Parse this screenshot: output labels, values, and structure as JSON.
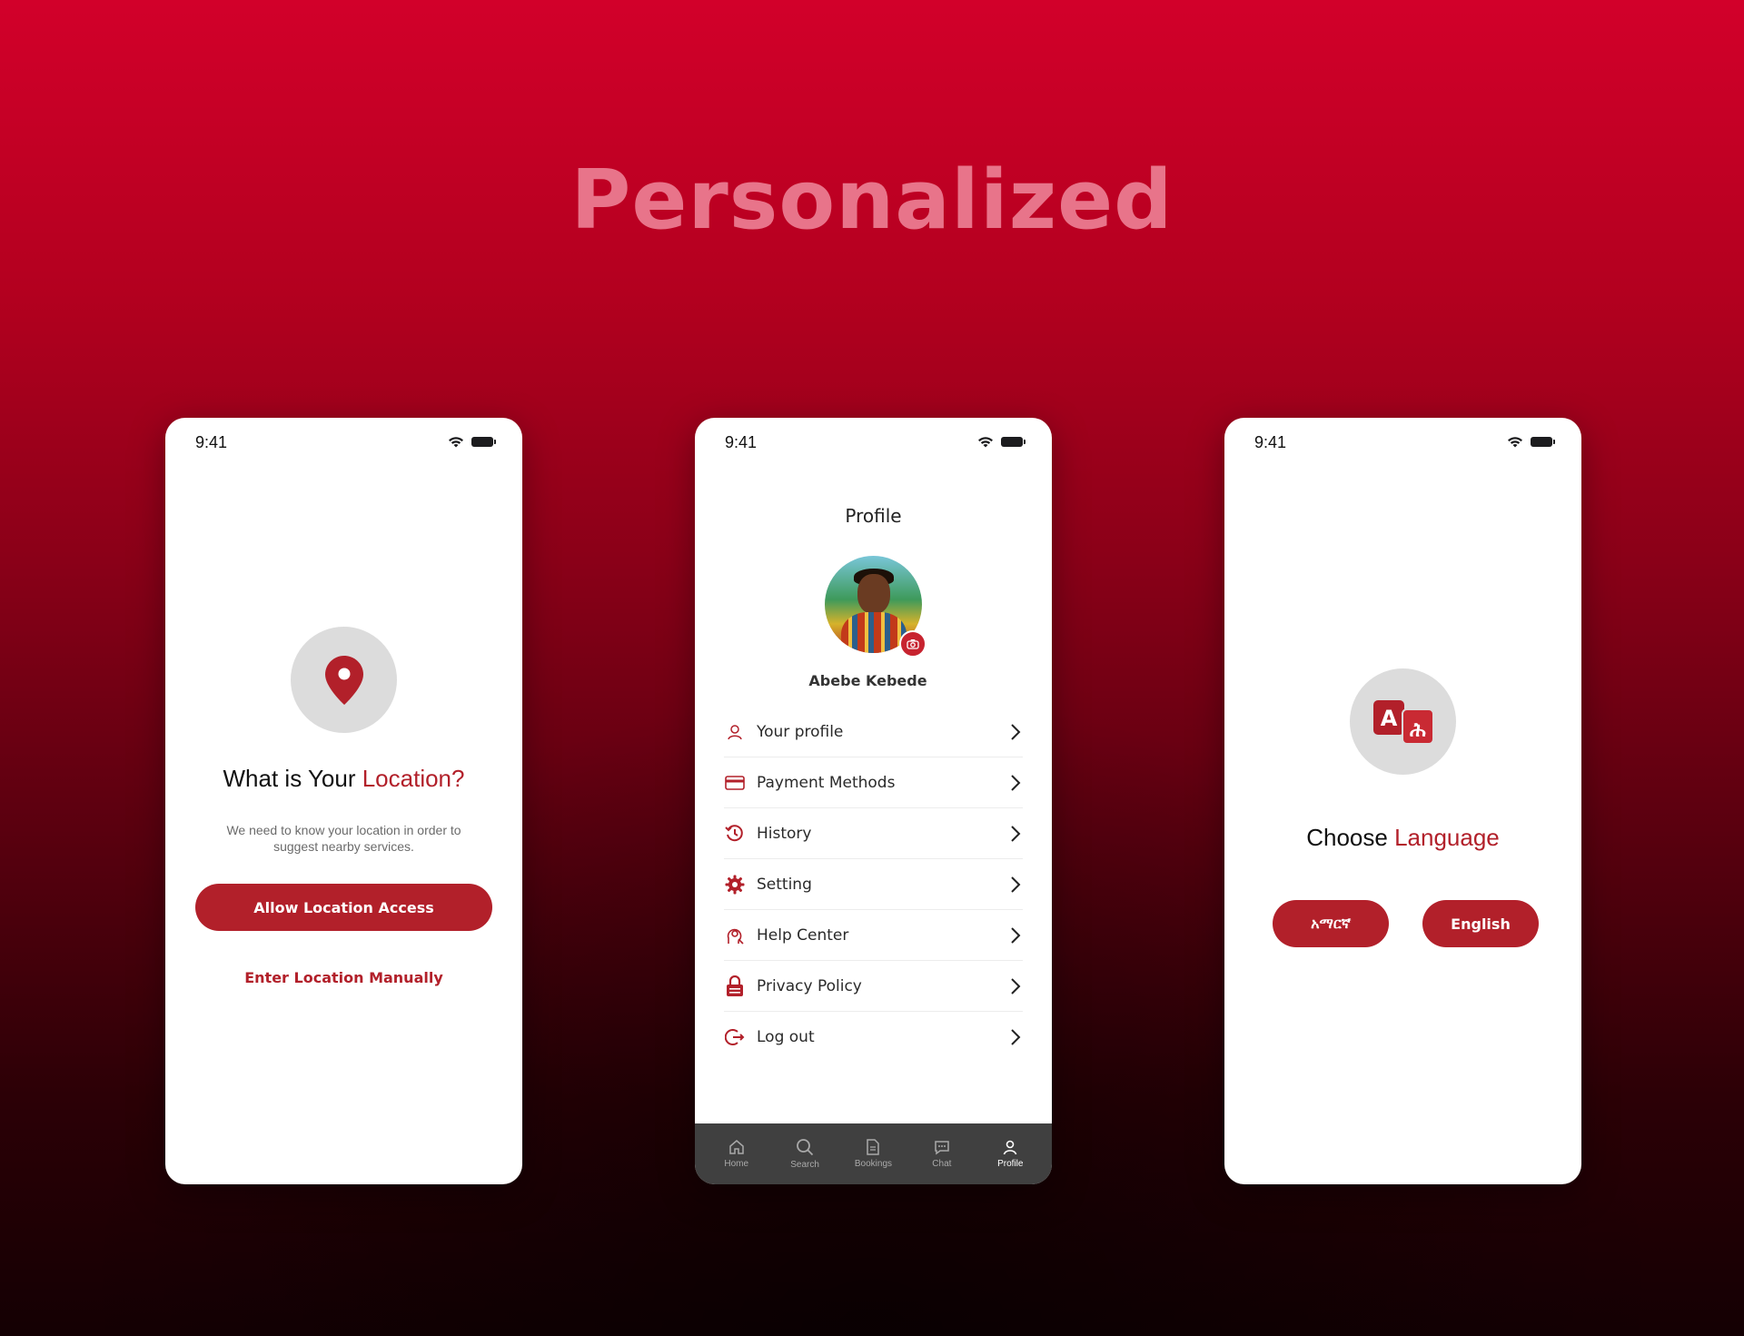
{
  "headline": "Personalized",
  "status_time": "9:41",
  "screen_location": {
    "title_prefix": "What is Your ",
    "title_accent": "Location?",
    "description": "We need to know your location in order to suggest nearby services.",
    "allow_button": "Allow Location Access",
    "manual_link": "Enter Location Manually",
    "icon": "location-pin-icon"
  },
  "screen_profile": {
    "title": "Profile",
    "user_name": "Abebe Kebede",
    "menu": [
      {
        "label": "Your profile",
        "icon": "user-icon"
      },
      {
        "label": "Payment Methods",
        "icon": "credit-card-icon"
      },
      {
        "label": "History",
        "icon": "history-icon"
      },
      {
        "label": "Setting",
        "icon": "gear-icon"
      },
      {
        "label": "Help Center",
        "icon": "help-icon"
      },
      {
        "label": "Privacy Policy",
        "icon": "lock-icon"
      },
      {
        "label": "Log out",
        "icon": "logout-icon"
      }
    ],
    "tabs": [
      {
        "label": "Home",
        "icon": "home-icon"
      },
      {
        "label": "Search",
        "icon": "search-icon"
      },
      {
        "label": "Bookings",
        "icon": "document-icon"
      },
      {
        "label": "Chat",
        "icon": "chat-icon"
      },
      {
        "label": "Profile",
        "icon": "profile-icon",
        "active": true
      }
    ]
  },
  "screen_language": {
    "title_prefix": "Choose ",
    "title_accent": "Language",
    "options": [
      "አማርኛ",
      "English"
    ],
    "icon": "translate-icon",
    "icon_letters": [
      "A",
      "ሕ"
    ]
  },
  "colors": {
    "accent": "#b2202a",
    "background_top": "#d2002a",
    "background_bottom": "#140003",
    "tabbar": "#404040"
  }
}
